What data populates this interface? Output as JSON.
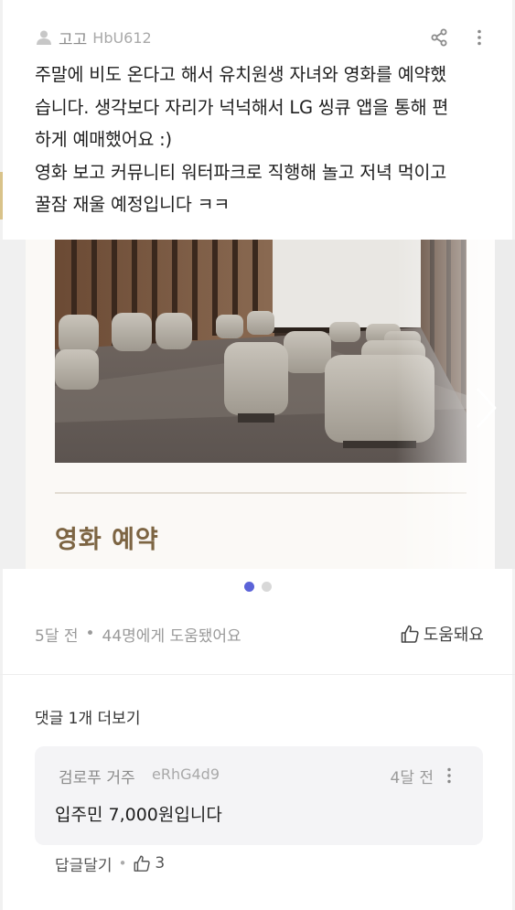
{
  "post": {
    "author": {
      "name": "고고",
      "id": "HbU612",
      "icon": "person-icon"
    },
    "body_lines": [
      "주말에 비도 온다고 해서 유치원생 자녀와 영화를 예약했",
      "습니다. 생각보다 자리가 넉넉해서 LG 씽큐 앱을 통해 편",
      "하게 예매했어요 :)",
      "영화 보고 커뮤니티 워터파크로 직행해 놀고 저녁 먹이고",
      "꿀잠 재울 예정입니다 ㅋㅋ"
    ],
    "actions": {
      "share_icon": "share-icon",
      "more_icon": "more-vertical-icon"
    }
  },
  "carousel": {
    "slide_caption": "영화 예약",
    "photo_subject": "theater-seats-photo",
    "total_slides": 2,
    "active_slide": 1,
    "next_icon": "chevron-right-icon"
  },
  "meta": {
    "time": "5달 전",
    "separator": "•",
    "helpful_count_text": "44명에게 도움됐어요",
    "helpful_button_label": "도움돼요",
    "helpful_icon": "thumbs-up-icon"
  },
  "comments": {
    "more_label": "댓글 1개 더보기",
    "items": [
      {
        "author": "검로푸 거주",
        "id": "eRhG4d9",
        "time": "4달 전",
        "text": "입주민 7,000원입니다",
        "reply_label": "답글달기",
        "separator": "•",
        "likes": "3"
      }
    ]
  },
  "colors": {
    "accent_dot": "#5b63d8",
    "caption_brown": "#7d6543",
    "comment_bg": "#f4f4f6"
  }
}
